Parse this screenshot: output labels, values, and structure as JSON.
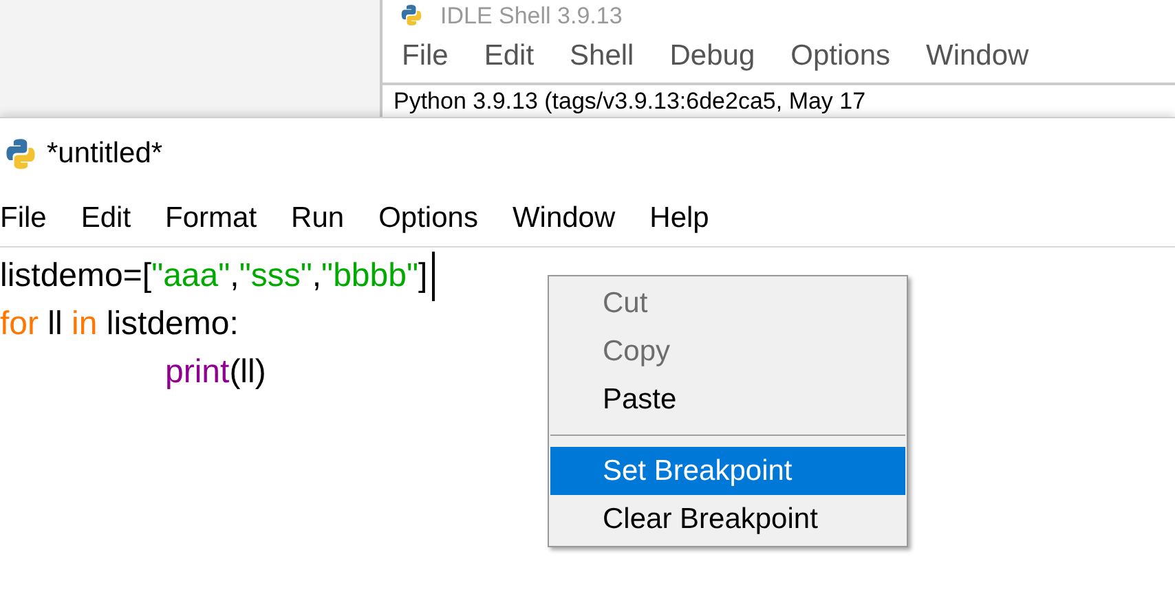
{
  "shell_window": {
    "title": "IDLE Shell 3.9.13",
    "menu": [
      "File",
      "Edit",
      "Shell",
      "Debug",
      "Options",
      "Window"
    ],
    "output_line": "Python 3.9.13 (tags/v3.9.13:6de2ca5, May 17"
  },
  "editor_window": {
    "title": "*untitled*",
    "menu": [
      "File",
      "Edit",
      "Format",
      "Run",
      "Options",
      "Window",
      "Help"
    ],
    "code_lines": [
      {
        "tokens": [
          {
            "text": "listdemo=[",
            "kind": "plain"
          },
          {
            "text": "\"aaa\"",
            "kind": "string"
          },
          {
            "text": ",",
            "kind": "plain"
          },
          {
            "text": "\"sss\"",
            "kind": "string"
          },
          {
            "text": ",",
            "kind": "plain"
          },
          {
            "text": "\"bbbb\"",
            "kind": "string"
          },
          {
            "text": "]",
            "kind": "plain"
          }
        ],
        "cursor": true
      },
      {
        "tokens": [
          {
            "text": "for",
            "kind": "keyword"
          },
          {
            "text": " ll ",
            "kind": "plain"
          },
          {
            "text": "in",
            "kind": "keyword"
          },
          {
            "text": " listdemo:",
            "kind": "plain"
          }
        ],
        "cursor": false,
        "children": [
          {
            "tokens": [
              {
                "text": "print",
                "kind": "builtin"
              },
              {
                "text": "(ll)",
                "kind": "plain"
              }
            ],
            "cursor": false
          }
        ]
      }
    ]
  },
  "context_menu": [
    {
      "kind": "item",
      "label": "Cut",
      "disabled": true,
      "selected": false
    },
    {
      "kind": "item",
      "label": "Copy",
      "disabled": true,
      "selected": false
    },
    {
      "kind": "item",
      "label": "Paste",
      "disabled": false,
      "selected": false
    },
    {
      "kind": "separator"
    },
    {
      "kind": "item",
      "label": "Set Breakpoint",
      "disabled": false,
      "selected": true
    },
    {
      "kind": "item",
      "label": "Clear Breakpoint",
      "disabled": false,
      "selected": false
    }
  ]
}
